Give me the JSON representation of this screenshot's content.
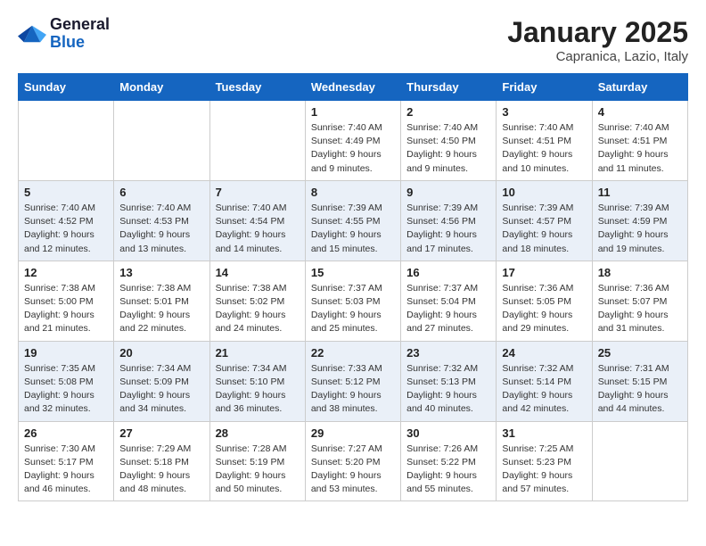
{
  "header": {
    "logo_general": "General",
    "logo_blue": "Blue",
    "month_title": "January 2025",
    "location": "Capranica, Lazio, Italy"
  },
  "weekdays": [
    "Sunday",
    "Monday",
    "Tuesday",
    "Wednesday",
    "Thursday",
    "Friday",
    "Saturday"
  ],
  "weeks": [
    [
      {
        "day": "",
        "sunrise": "",
        "sunset": "",
        "daylight": ""
      },
      {
        "day": "",
        "sunrise": "",
        "sunset": "",
        "daylight": ""
      },
      {
        "day": "",
        "sunrise": "",
        "sunset": "",
        "daylight": ""
      },
      {
        "day": "1",
        "sunrise": "Sunrise: 7:40 AM",
        "sunset": "Sunset: 4:49 PM",
        "daylight": "Daylight: 9 hours and 9 minutes."
      },
      {
        "day": "2",
        "sunrise": "Sunrise: 7:40 AM",
        "sunset": "Sunset: 4:50 PM",
        "daylight": "Daylight: 9 hours and 9 minutes."
      },
      {
        "day": "3",
        "sunrise": "Sunrise: 7:40 AM",
        "sunset": "Sunset: 4:51 PM",
        "daylight": "Daylight: 9 hours and 10 minutes."
      },
      {
        "day": "4",
        "sunrise": "Sunrise: 7:40 AM",
        "sunset": "Sunset: 4:51 PM",
        "daylight": "Daylight: 9 hours and 11 minutes."
      }
    ],
    [
      {
        "day": "5",
        "sunrise": "Sunrise: 7:40 AM",
        "sunset": "Sunset: 4:52 PM",
        "daylight": "Daylight: 9 hours and 12 minutes."
      },
      {
        "day": "6",
        "sunrise": "Sunrise: 7:40 AM",
        "sunset": "Sunset: 4:53 PM",
        "daylight": "Daylight: 9 hours and 13 minutes."
      },
      {
        "day": "7",
        "sunrise": "Sunrise: 7:40 AM",
        "sunset": "Sunset: 4:54 PM",
        "daylight": "Daylight: 9 hours and 14 minutes."
      },
      {
        "day": "8",
        "sunrise": "Sunrise: 7:39 AM",
        "sunset": "Sunset: 4:55 PM",
        "daylight": "Daylight: 9 hours and 15 minutes."
      },
      {
        "day": "9",
        "sunrise": "Sunrise: 7:39 AM",
        "sunset": "Sunset: 4:56 PM",
        "daylight": "Daylight: 9 hours and 17 minutes."
      },
      {
        "day": "10",
        "sunrise": "Sunrise: 7:39 AM",
        "sunset": "Sunset: 4:57 PM",
        "daylight": "Daylight: 9 hours and 18 minutes."
      },
      {
        "day": "11",
        "sunrise": "Sunrise: 7:39 AM",
        "sunset": "Sunset: 4:59 PM",
        "daylight": "Daylight: 9 hours and 19 minutes."
      }
    ],
    [
      {
        "day": "12",
        "sunrise": "Sunrise: 7:38 AM",
        "sunset": "Sunset: 5:00 PM",
        "daylight": "Daylight: 9 hours and 21 minutes."
      },
      {
        "day": "13",
        "sunrise": "Sunrise: 7:38 AM",
        "sunset": "Sunset: 5:01 PM",
        "daylight": "Daylight: 9 hours and 22 minutes."
      },
      {
        "day": "14",
        "sunrise": "Sunrise: 7:38 AM",
        "sunset": "Sunset: 5:02 PM",
        "daylight": "Daylight: 9 hours and 24 minutes."
      },
      {
        "day": "15",
        "sunrise": "Sunrise: 7:37 AM",
        "sunset": "Sunset: 5:03 PM",
        "daylight": "Daylight: 9 hours and 25 minutes."
      },
      {
        "day": "16",
        "sunrise": "Sunrise: 7:37 AM",
        "sunset": "Sunset: 5:04 PM",
        "daylight": "Daylight: 9 hours and 27 minutes."
      },
      {
        "day": "17",
        "sunrise": "Sunrise: 7:36 AM",
        "sunset": "Sunset: 5:05 PM",
        "daylight": "Daylight: 9 hours and 29 minutes."
      },
      {
        "day": "18",
        "sunrise": "Sunrise: 7:36 AM",
        "sunset": "Sunset: 5:07 PM",
        "daylight": "Daylight: 9 hours and 31 minutes."
      }
    ],
    [
      {
        "day": "19",
        "sunrise": "Sunrise: 7:35 AM",
        "sunset": "Sunset: 5:08 PM",
        "daylight": "Daylight: 9 hours and 32 minutes."
      },
      {
        "day": "20",
        "sunrise": "Sunrise: 7:34 AM",
        "sunset": "Sunset: 5:09 PM",
        "daylight": "Daylight: 9 hours and 34 minutes."
      },
      {
        "day": "21",
        "sunrise": "Sunrise: 7:34 AM",
        "sunset": "Sunset: 5:10 PM",
        "daylight": "Daylight: 9 hours and 36 minutes."
      },
      {
        "day": "22",
        "sunrise": "Sunrise: 7:33 AM",
        "sunset": "Sunset: 5:12 PM",
        "daylight": "Daylight: 9 hours and 38 minutes."
      },
      {
        "day": "23",
        "sunrise": "Sunrise: 7:32 AM",
        "sunset": "Sunset: 5:13 PM",
        "daylight": "Daylight: 9 hours and 40 minutes."
      },
      {
        "day": "24",
        "sunrise": "Sunrise: 7:32 AM",
        "sunset": "Sunset: 5:14 PM",
        "daylight": "Daylight: 9 hours and 42 minutes."
      },
      {
        "day": "25",
        "sunrise": "Sunrise: 7:31 AM",
        "sunset": "Sunset: 5:15 PM",
        "daylight": "Daylight: 9 hours and 44 minutes."
      }
    ],
    [
      {
        "day": "26",
        "sunrise": "Sunrise: 7:30 AM",
        "sunset": "Sunset: 5:17 PM",
        "daylight": "Daylight: 9 hours and 46 minutes."
      },
      {
        "day": "27",
        "sunrise": "Sunrise: 7:29 AM",
        "sunset": "Sunset: 5:18 PM",
        "daylight": "Daylight: 9 hours and 48 minutes."
      },
      {
        "day": "28",
        "sunrise": "Sunrise: 7:28 AM",
        "sunset": "Sunset: 5:19 PM",
        "daylight": "Daylight: 9 hours and 50 minutes."
      },
      {
        "day": "29",
        "sunrise": "Sunrise: 7:27 AM",
        "sunset": "Sunset: 5:20 PM",
        "daylight": "Daylight: 9 hours and 53 minutes."
      },
      {
        "day": "30",
        "sunrise": "Sunrise: 7:26 AM",
        "sunset": "Sunset: 5:22 PM",
        "daylight": "Daylight: 9 hours and 55 minutes."
      },
      {
        "day": "31",
        "sunrise": "Sunrise: 7:25 AM",
        "sunset": "Sunset: 5:23 PM",
        "daylight": "Daylight: 9 hours and 57 minutes."
      },
      {
        "day": "",
        "sunrise": "",
        "sunset": "",
        "daylight": ""
      }
    ]
  ]
}
